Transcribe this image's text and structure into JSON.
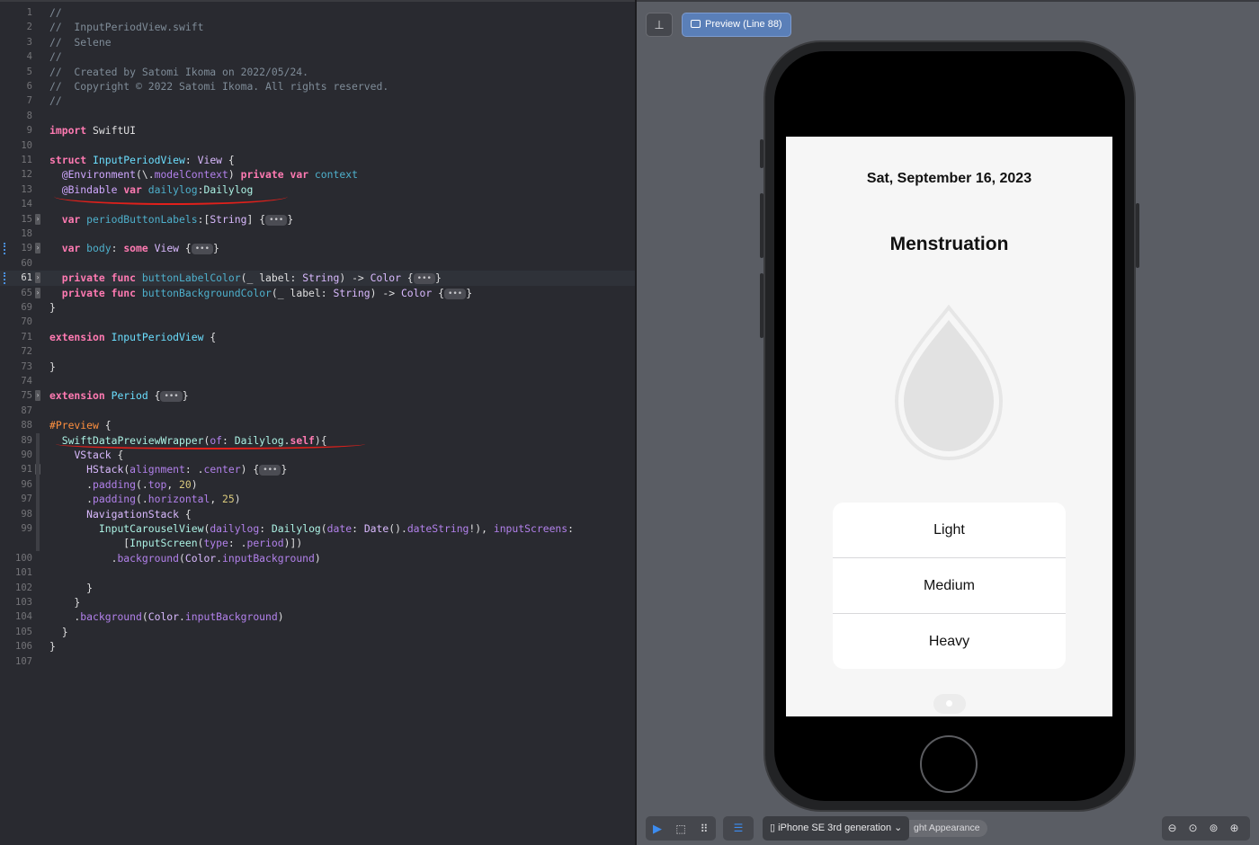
{
  "editor": {
    "lines": [
      {
        "n": "1",
        "tokens": [
          [
            "comment",
            "//"
          ]
        ]
      },
      {
        "n": "2",
        "tokens": [
          [
            "comment",
            "//  InputPeriodView.swift"
          ]
        ]
      },
      {
        "n": "3",
        "tokens": [
          [
            "comment",
            "//  Selene"
          ]
        ]
      },
      {
        "n": "4",
        "tokens": [
          [
            "comment",
            "//"
          ]
        ]
      },
      {
        "n": "5",
        "tokens": [
          [
            "comment",
            "//  Created by Satomi Ikoma on 2022/05/24."
          ]
        ]
      },
      {
        "n": "6",
        "tokens": [
          [
            "comment",
            "//  Copyright © 2022 Satomi Ikoma. All rights reserved."
          ]
        ]
      },
      {
        "n": "7",
        "tokens": [
          [
            "comment",
            "//"
          ]
        ]
      },
      {
        "n": "8",
        "tokens": []
      },
      {
        "n": "9",
        "tokens": [
          [
            "kw",
            "import"
          ],
          [
            "other",
            " SwiftUI"
          ]
        ]
      },
      {
        "n": "10",
        "tokens": []
      },
      {
        "n": "11",
        "tokens": [
          [
            "kw",
            "struct"
          ],
          [
            "other",
            " "
          ],
          [
            "tdecl",
            "InputPeriodView"
          ],
          [
            "other",
            ": "
          ],
          [
            "type",
            "View"
          ],
          [
            "other",
            " {"
          ]
        ]
      },
      {
        "n": "12",
        "tokens": [
          [
            "other",
            "  "
          ],
          [
            "attr",
            "@Environment"
          ],
          [
            "other",
            "(\\."
          ],
          [
            "prop",
            "modelContext"
          ],
          [
            "other",
            ") "
          ],
          [
            "kw",
            "private"
          ],
          [
            "other",
            " "
          ],
          [
            "kw",
            "var"
          ],
          [
            "other",
            " "
          ],
          [
            "vdecl",
            "context"
          ]
        ]
      },
      {
        "n": "13",
        "tokens": [
          [
            "other",
            "  "
          ],
          [
            "attr",
            "@Bindable"
          ],
          [
            "other",
            " "
          ],
          [
            "kw",
            "var"
          ],
          [
            "other",
            " "
          ],
          [
            "vdecl",
            "dailylog"
          ],
          [
            "other",
            ":"
          ],
          [
            "proj",
            "Dailylog"
          ]
        ]
      },
      {
        "n": "14",
        "tokens": []
      },
      {
        "n": "15",
        "fold": true,
        "tokens": [
          [
            "other",
            "  "
          ],
          [
            "kw",
            "var"
          ],
          [
            "other",
            " "
          ],
          [
            "vdecl",
            "periodButtonLabels"
          ],
          [
            "other",
            ":["
          ],
          [
            "type",
            "String"
          ],
          [
            "other",
            "] {"
          ],
          [
            "ell",
            "•••"
          ],
          [
            "other",
            "}"
          ]
        ]
      },
      {
        "n": "18",
        "tokens": []
      },
      {
        "n": "19",
        "fold": true,
        "tokens": [
          [
            "other",
            "  "
          ],
          [
            "kw",
            "var"
          ],
          [
            "other",
            " "
          ],
          [
            "vdecl",
            "body"
          ],
          [
            "other",
            ": "
          ],
          [
            "kw",
            "some"
          ],
          [
            "other",
            " "
          ],
          [
            "type",
            "View"
          ],
          [
            "other",
            " {"
          ],
          [
            "ell",
            "•••"
          ],
          [
            "other",
            "}"
          ]
        ]
      },
      {
        "n": "60",
        "tokens": []
      },
      {
        "n": "61",
        "fold": true,
        "current": true,
        "tokens": [
          [
            "other",
            "  "
          ],
          [
            "kw",
            "private"
          ],
          [
            "other",
            " "
          ],
          [
            "kw",
            "func"
          ],
          [
            "other",
            " "
          ],
          [
            "vdecl",
            "buttonLabelColor"
          ],
          [
            "other",
            "(_ label: "
          ],
          [
            "type",
            "String"
          ],
          [
            "other",
            ") -> "
          ],
          [
            "type",
            "Color"
          ],
          [
            "other",
            " {"
          ],
          [
            "ell",
            "•••"
          ],
          [
            "other",
            "}"
          ]
        ]
      },
      {
        "n": "65",
        "fold": true,
        "tokens": [
          [
            "other",
            "  "
          ],
          [
            "kw",
            "private"
          ],
          [
            "other",
            " "
          ],
          [
            "kw",
            "func"
          ],
          [
            "other",
            " "
          ],
          [
            "vdecl",
            "buttonBackgroundColor"
          ],
          [
            "other",
            "(_ label: "
          ],
          [
            "type",
            "String"
          ],
          [
            "other",
            ") -> "
          ],
          [
            "type",
            "Color"
          ],
          [
            "other",
            " {"
          ],
          [
            "ell",
            "•••"
          ],
          [
            "other",
            "}"
          ]
        ]
      },
      {
        "n": "69",
        "tokens": [
          [
            "other",
            "}"
          ]
        ]
      },
      {
        "n": "70",
        "tokens": []
      },
      {
        "n": "71",
        "tokens": [
          [
            "kw",
            "extension"
          ],
          [
            "other",
            " "
          ],
          [
            "tdecl",
            "InputPeriodView"
          ],
          [
            "other",
            " {"
          ]
        ]
      },
      {
        "n": "72",
        "tokens": []
      },
      {
        "n": "73",
        "tokens": [
          [
            "other",
            "}"
          ]
        ]
      },
      {
        "n": "74",
        "tokens": []
      },
      {
        "n": "75",
        "fold": true,
        "tokens": [
          [
            "kw",
            "extension"
          ],
          [
            "other",
            " "
          ],
          [
            "tdecl",
            "Period"
          ],
          [
            "other",
            " {"
          ],
          [
            "ell",
            "•••"
          ],
          [
            "other",
            "}"
          ]
        ]
      },
      {
        "n": "87",
        "tokens": []
      },
      {
        "n": "88",
        "tokens": [
          [
            "macro",
            "#Preview"
          ],
          [
            "other",
            " {"
          ]
        ]
      },
      {
        "n": "89",
        "tokens": [
          [
            "other",
            "  "
          ],
          [
            "proj",
            "SwiftDataPreviewWrapper"
          ],
          [
            "other",
            "("
          ],
          [
            "prop",
            "of"
          ],
          [
            "other",
            ": "
          ],
          [
            "proj",
            "Dailylog"
          ],
          [
            "other",
            "."
          ],
          [
            "kw",
            "self"
          ],
          [
            "other",
            "){"
          ]
        ]
      },
      {
        "n": "90",
        "tokens": [
          [
            "other",
            "    "
          ],
          [
            "type",
            "VStack"
          ],
          [
            "other",
            " {"
          ]
        ]
      },
      {
        "n": "91",
        "fold": true,
        "tokens": [
          [
            "other",
            "      "
          ],
          [
            "type",
            "HStack"
          ],
          [
            "other",
            "("
          ],
          [
            "prop",
            "alignment"
          ],
          [
            "other",
            ": ."
          ],
          [
            "prop",
            "center"
          ],
          [
            "other",
            ") {"
          ],
          [
            "ell",
            "•••"
          ],
          [
            "other",
            "}"
          ]
        ]
      },
      {
        "n": "96",
        "tokens": [
          [
            "other",
            "      ."
          ],
          [
            "prop",
            "padding"
          ],
          [
            "other",
            "(."
          ],
          [
            "prop",
            "top"
          ],
          [
            "other",
            ", "
          ],
          [
            "num",
            "20"
          ],
          [
            "other",
            ")"
          ]
        ]
      },
      {
        "n": "97",
        "tokens": [
          [
            "other",
            "      ."
          ],
          [
            "prop",
            "padding"
          ],
          [
            "other",
            "(."
          ],
          [
            "prop",
            "horizontal"
          ],
          [
            "other",
            ", "
          ],
          [
            "num",
            "25"
          ],
          [
            "other",
            ")"
          ]
        ]
      },
      {
        "n": "98",
        "tokens": [
          [
            "other",
            "      "
          ],
          [
            "type",
            "NavigationStack"
          ],
          [
            "other",
            " {"
          ]
        ]
      },
      {
        "n": "99",
        "tokens": [
          [
            "other",
            "        "
          ],
          [
            "proj",
            "InputCarouselView"
          ],
          [
            "other",
            "("
          ],
          [
            "prop",
            "dailylog"
          ],
          [
            "other",
            ": "
          ],
          [
            "proj",
            "Dailylog"
          ],
          [
            "other",
            "("
          ],
          [
            "prop",
            "date"
          ],
          [
            "other",
            ": "
          ],
          [
            "type",
            "Date"
          ],
          [
            "other",
            "()."
          ],
          [
            "prop",
            "dateString"
          ],
          [
            "other",
            "!), "
          ],
          [
            "prop",
            "inputScreens"
          ],
          [
            "other",
            ":"
          ]
        ]
      },
      {
        "n": "",
        "tokens": [
          [
            "other",
            "            ["
          ],
          [
            "proj",
            "InputScreen"
          ],
          [
            "other",
            "("
          ],
          [
            "prop",
            "type"
          ],
          [
            "other",
            ": ."
          ],
          [
            "prop",
            "period"
          ],
          [
            "other",
            ")])"
          ]
        ]
      },
      {
        "n": "100",
        "tokens": [
          [
            "other",
            "          ."
          ],
          [
            "prop",
            "background"
          ],
          [
            "other",
            "("
          ],
          [
            "type",
            "Color"
          ],
          [
            "other",
            "."
          ],
          [
            "prop",
            "inputBackground"
          ],
          [
            "other",
            ")"
          ]
        ]
      },
      {
        "n": "101",
        "tokens": []
      },
      {
        "n": "102",
        "tokens": [
          [
            "other",
            "      }"
          ]
        ]
      },
      {
        "n": "103",
        "tokens": [
          [
            "other",
            "    }"
          ]
        ]
      },
      {
        "n": "104",
        "tokens": [
          [
            "other",
            "    ."
          ],
          [
            "prop",
            "background"
          ],
          [
            "other",
            "("
          ],
          [
            "type",
            "Color"
          ],
          [
            "other",
            "."
          ],
          [
            "prop",
            "inputBackground"
          ],
          [
            "other",
            ")"
          ]
        ]
      },
      {
        "n": "105",
        "tokens": [
          [
            "other",
            "  }"
          ]
        ]
      },
      {
        "n": "106",
        "tokens": [
          [
            "other",
            "}"
          ]
        ]
      },
      {
        "n": "107",
        "tokens": []
      }
    ]
  },
  "canvas": {
    "pin_icon": "pin-icon",
    "preview_label": "Preview (Line 88)",
    "app": {
      "date": "Sat, September 16, 2023",
      "title": "Menstruation",
      "drop_icon": "drop-icon",
      "options": [
        "Light",
        "Medium",
        "Heavy"
      ]
    },
    "toolbar": {
      "light_appearance": "ght Appearance",
      "device": "iPhone SE 3rd generation",
      "icons": [
        "play-icon",
        "select-icon",
        "variants-icon",
        "device-settings-icon",
        "zoom-out-icon",
        "zoom-fit-icon",
        "zoom-100-icon",
        "zoom-in-icon"
      ]
    }
  },
  "colors": {
    "editor_bg": "#292a30",
    "canvas_bg": "#5a5d64",
    "accent": "#5a7fb8",
    "annotation": "#e0201b"
  }
}
